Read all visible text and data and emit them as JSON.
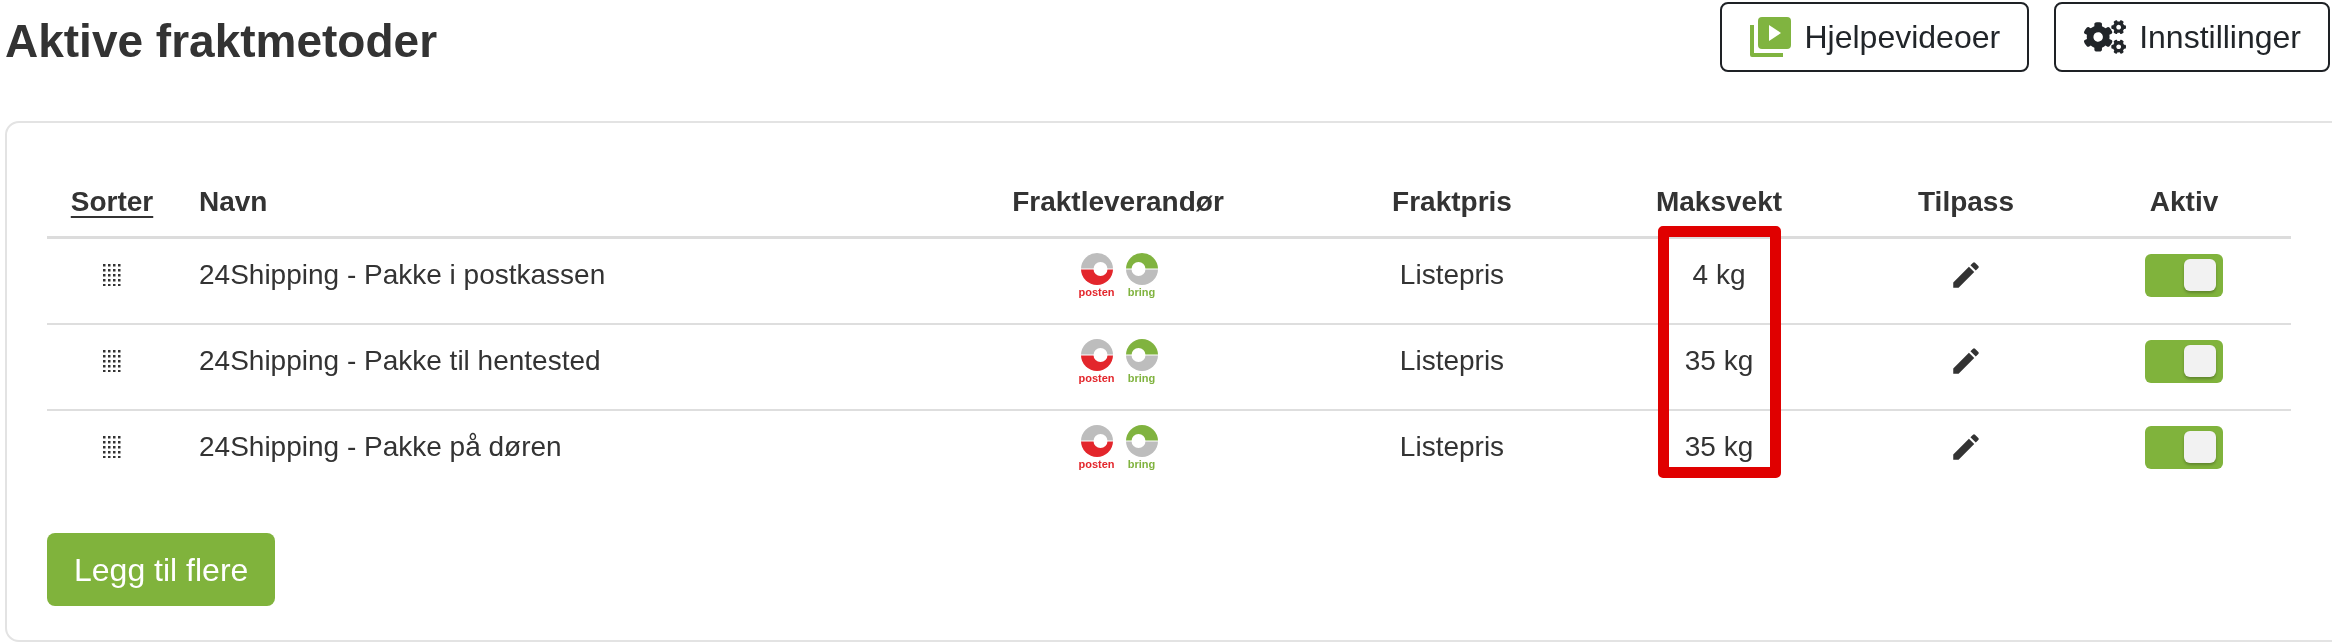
{
  "title": "Aktive fraktmetoder",
  "header_buttons": [
    {
      "kind": "video",
      "label": "Hjelpevideoer"
    },
    {
      "kind": "settings",
      "label": "Innstillinger"
    }
  ],
  "table": {
    "columns": [
      {
        "label": "Sorter",
        "kind": "link",
        "highlighted": false
      },
      {
        "label": "Navn",
        "kind": "text",
        "highlighted": false
      },
      {
        "label": "Fraktleverandør",
        "kind": "text",
        "highlighted": false
      },
      {
        "label": "Fraktpris",
        "kind": "text",
        "highlighted": false
      },
      {
        "label": "Maksvekt",
        "kind": "text",
        "highlighted": true
      },
      {
        "label": "Tilpass",
        "kind": "text",
        "highlighted": false
      },
      {
        "label": "Aktiv",
        "kind": "text",
        "highlighted": false
      }
    ],
    "rows": [
      {
        "name": "24Shipping - Pakke i postkassen",
        "carriers": [
          {
            "name": "posten",
            "kind": "lower",
            "color": "#e3262c"
          },
          {
            "name": "bring",
            "kind": "upper",
            "color": "#80b33f"
          }
        ],
        "price": "Listepris",
        "max_weight": "4 kg",
        "active": true
      },
      {
        "name": "24Shipping - Pakke til hentested",
        "carriers": [
          {
            "name": "posten",
            "kind": "lower",
            "color": "#e3262c"
          },
          {
            "name": "bring",
            "kind": "upper",
            "color": "#80b33f"
          }
        ],
        "price": "Listepris",
        "max_weight": "35 kg",
        "active": true
      },
      {
        "name": "24Shipping - Pakke på døren",
        "carriers": [
          {
            "name": "posten",
            "kind": "lower",
            "color": "#e3262c"
          },
          {
            "name": "bring",
            "kind": "upper",
            "color": "#80b33f"
          }
        ],
        "price": "Listepris",
        "max_weight": "35 kg",
        "active": true
      }
    ]
  },
  "add_button": {
    "label": "Legg til flere"
  }
}
